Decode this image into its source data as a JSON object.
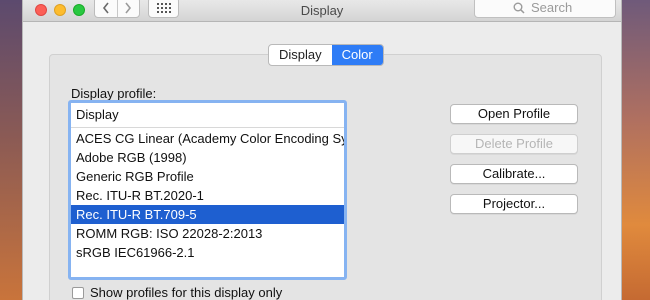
{
  "window": {
    "title": "Display"
  },
  "toolbar": {
    "back_icon": "chevron-left-icon",
    "forward_icon": "chevron-right-icon",
    "grid_icon": "grid-icon",
    "search_placeholder": "Search"
  },
  "tabs": [
    {
      "label": "Display",
      "active": false
    },
    {
      "label": "Color",
      "active": true
    }
  ],
  "profile": {
    "label": "Display profile:",
    "list_header": "Display",
    "items": [
      "ACES CG Linear (Academy Color Encoding Sy...",
      "Adobe RGB (1998)",
      "Generic RGB Profile",
      "Rec. ITU-R BT.2020-1",
      "Rec. ITU-R BT.709-5",
      "ROMM RGB: ISO 22028-2:2013",
      "sRGB IEC61966-2.1"
    ],
    "selected": "Rec. ITU-R BT.709-5"
  },
  "buttons": {
    "open_profile": "Open Profile",
    "delete_profile": "Delete Profile",
    "calibrate": "Calibrate...",
    "projector": "Projector..."
  },
  "checkbox": {
    "label": "Show profiles for this display only",
    "checked": false
  },
  "colors": {
    "accent": "#2e7cf6",
    "selection": "#1e5fd0",
    "focus_ring": "#86b3f1"
  }
}
